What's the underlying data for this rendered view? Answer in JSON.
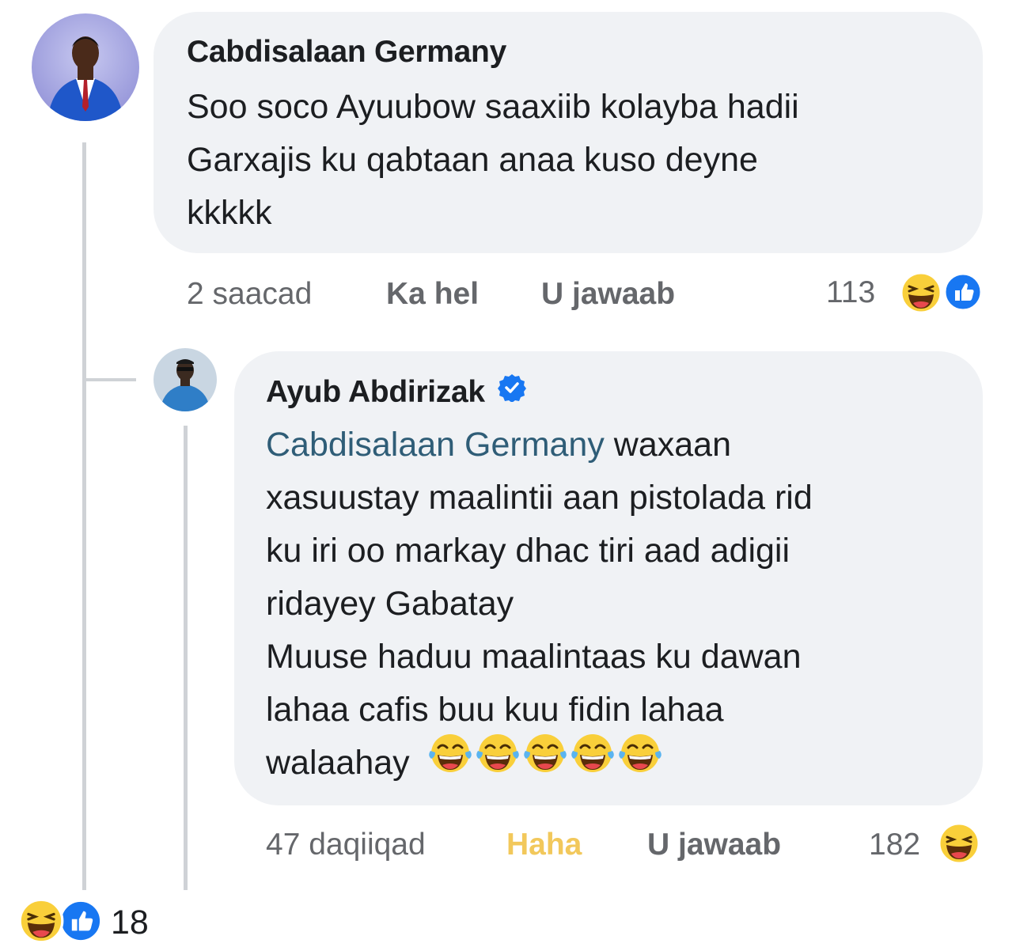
{
  "comment1": {
    "author": "Cabdisalaan Germany",
    "text_lines": [
      "Soo soco Ayuubow saaxiib kolayba hadii",
      "Garxajis ku qabtaan anaa kuso deyne",
      "kkkkk"
    ],
    "time": "2 saacad",
    "like_label": "Ka hel",
    "reply_label": "U jawaab",
    "reaction_count": "113",
    "reaction_icons": [
      "haha-icon",
      "like-icon"
    ]
  },
  "reply1": {
    "author": "Ayub Abdirizak",
    "verified": true,
    "mention": "Cabdisalaan Germany",
    "first_line_rest": " waxaan",
    "text_lines": [
      "xasuustay maalintii aan pistolada rid",
      "ku iri oo markay dhac tiri aad adigii",
      "ridayey Gabatay",
      "Muuse haduu maalintaas ku dawan",
      "lahaa cafis buu kuu fidin lahaa"
    ],
    "last_line": "walaahay",
    "trailing_emojis": [
      "tears-of-joy-icon",
      "tears-of-joy-icon",
      "tears-of-joy-icon",
      "tears-of-joy-icon",
      "tears-of-joy-icon"
    ],
    "time": "47 daqiiqad",
    "reaction_label": "Haha",
    "reply_label": "U jawaab",
    "reaction_count": "182",
    "reaction_icons": [
      "haha-icon"
    ]
  },
  "post_reactions": {
    "icons": [
      "haha-icon",
      "like-icon"
    ],
    "count": "18"
  },
  "colors": {
    "bubble": "#f0f2f5",
    "mention": "#2f5d77",
    "meta": "#65676b",
    "haha": "#f2c85b",
    "like_blue": "#1877f2"
  }
}
